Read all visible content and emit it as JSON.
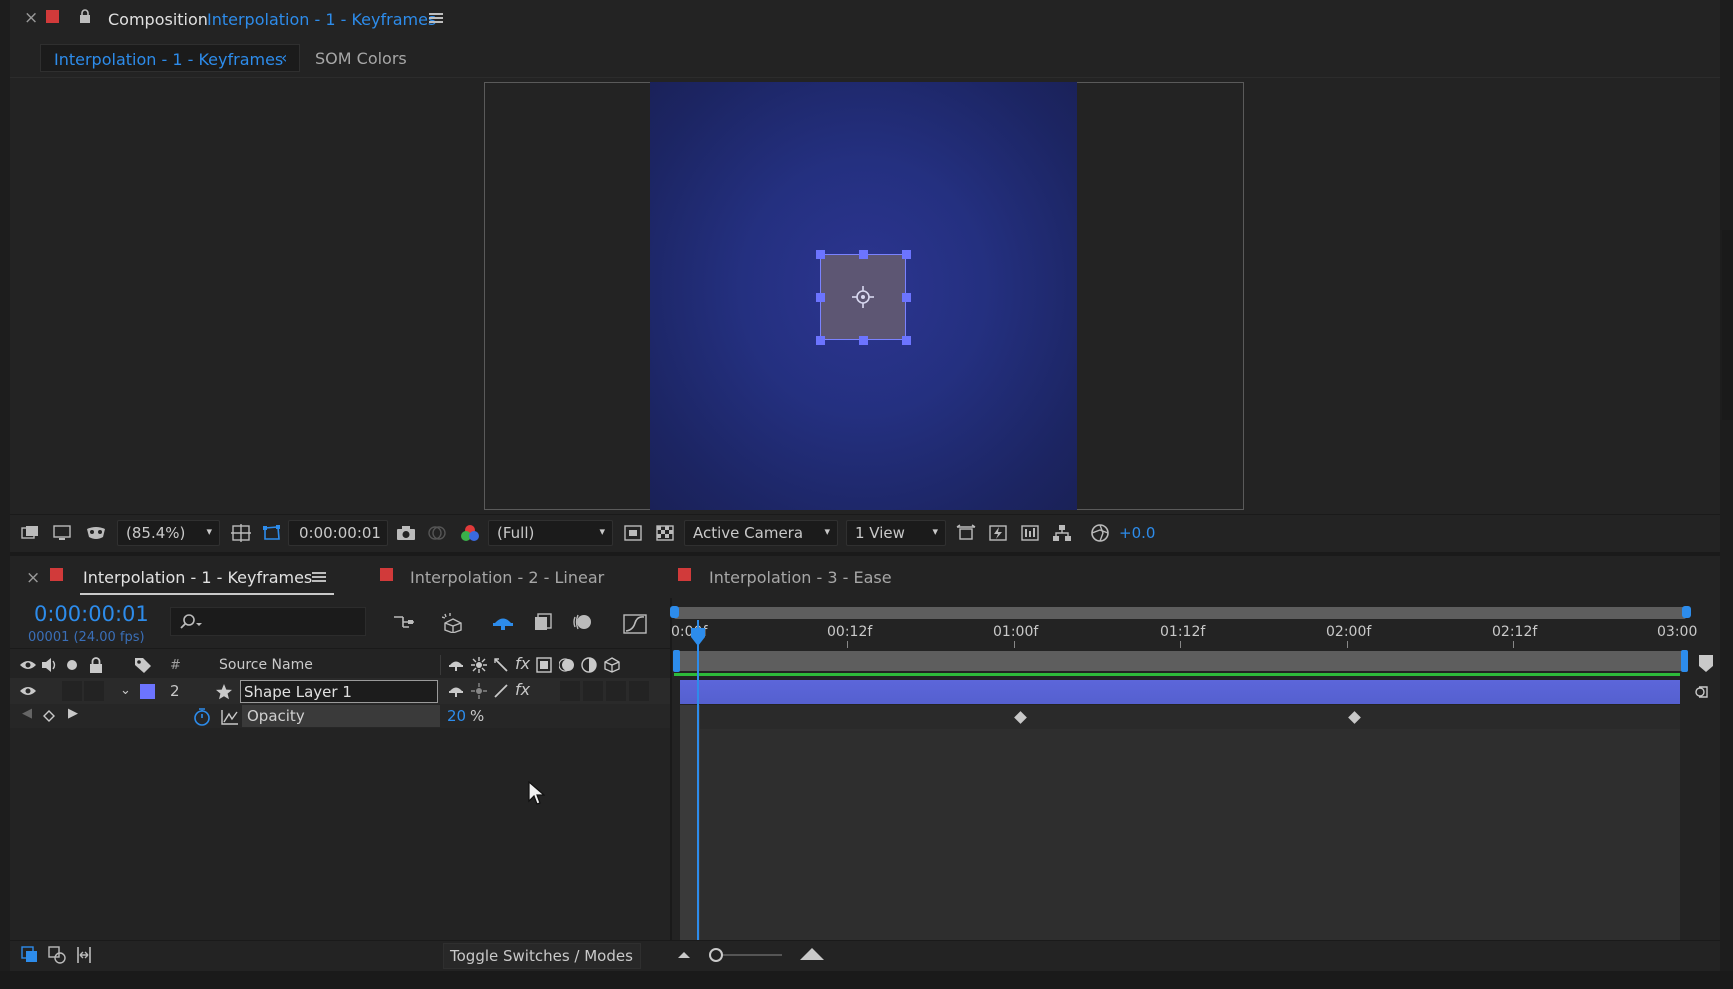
{
  "composition_panel": {
    "close": "×",
    "label": "Composition",
    "comp_name": "Interpolation - 1 - Keyframes",
    "subtabs": [
      "Interpolation - 1 - Keyframes",
      "SOM Colors"
    ]
  },
  "viewer_toolbar": {
    "magnification": "(85.4%)",
    "timecode": "0:00:00:01",
    "resolution": "(Full)",
    "camera": "Active Camera",
    "views": "1 View",
    "exposure": "+0.0"
  },
  "timeline": {
    "tabs": [
      {
        "label": "Interpolation - 1 - Keyframes",
        "active": true,
        "color": "#d13a3a"
      },
      {
        "label": "Interpolation - 2 - Linear",
        "active": false,
        "color": "#d13a3a"
      },
      {
        "label": "Interpolation - 3 - Ease",
        "active": false,
        "color": "#d13a3a"
      }
    ],
    "current_time": "0:00:00:01",
    "frame_info": "00001 (24.00 fps)",
    "columns": {
      "number": "#",
      "source_name": "Source Name"
    },
    "ruler_labels": [
      "0:00f",
      "00:12f",
      "01:00f",
      "01:12f",
      "02:00f",
      "02:12f",
      "03:00"
    ],
    "layer": {
      "number": "2",
      "name": "Shape Layer 1",
      "label_color": "#6c74ff"
    },
    "property": {
      "name": "Opacity",
      "value": "20",
      "unit": "%"
    },
    "keyframe_times": [
      "01:00f",
      "02:00f"
    ],
    "status": {
      "toggle_label": "Toggle Switches / Modes"
    }
  },
  "colors": {
    "accent": "#2d8ceb",
    "layer_bar": "#5a64d6",
    "label_red": "#d13a3a"
  }
}
